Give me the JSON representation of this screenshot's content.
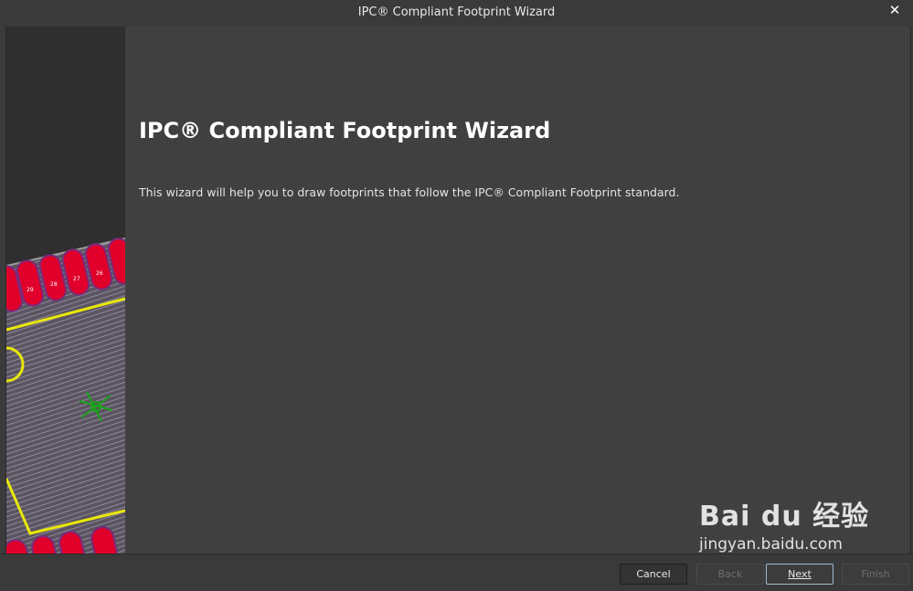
{
  "window": {
    "title": "IPC® Compliant Footprint Wizard",
    "close_glyph": "✕"
  },
  "main": {
    "heading": "IPC® Compliant Footprint Wizard",
    "description": "This wizard will help you to draw footprints that follow the IPC® Compliant Footprint standard."
  },
  "side_panel": {
    "pad_labels": [
      "29",
      "28",
      "27",
      "26"
    ]
  },
  "buttons": {
    "cancel": "Cancel",
    "back": "Back",
    "next": "Next",
    "finish": "Finish"
  },
  "watermark": {
    "brand": "Bai du 经验",
    "url": "jingyan.baidu.com"
  },
  "colors": {
    "pad": "#e0002a",
    "silkscreen": "#e8e80a",
    "stripe": "#8a7f9a",
    "marker": "#1aa31a"
  }
}
